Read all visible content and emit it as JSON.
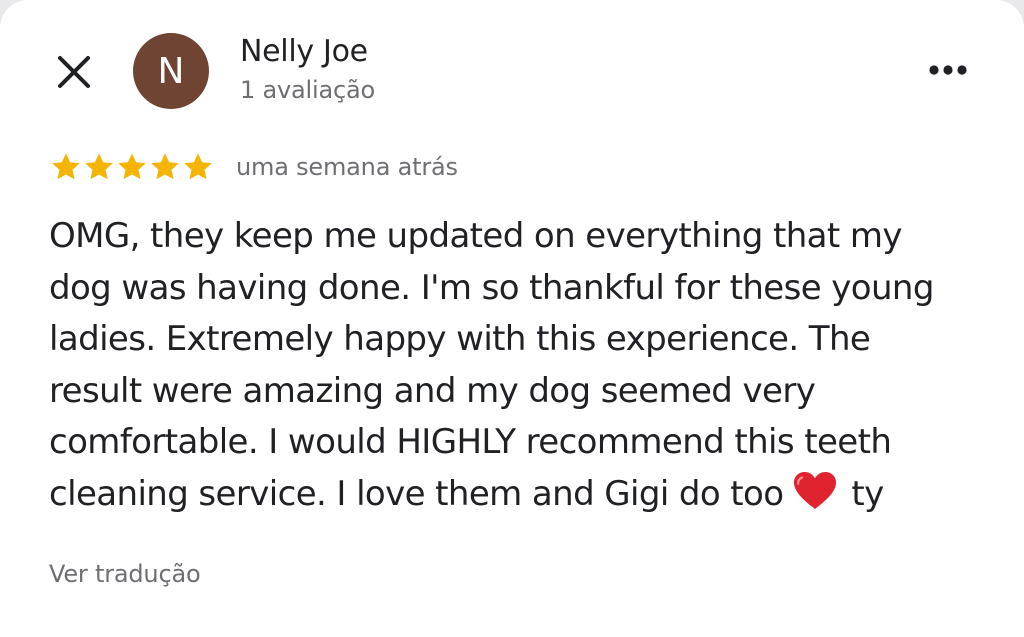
{
  "reviewer": {
    "avatar_initial": "N",
    "avatar_color": "#6f4433",
    "name": "Nelly Joe",
    "review_count": "1 avaliação"
  },
  "review": {
    "rating": 5,
    "max_rating": 5,
    "star_color": "#f4b400",
    "time_ago": "uma semana atrás",
    "text_main": "OMG, they keep me updated on everything that my\ndog was having done. I'm so thankful for these young\nladies. Extremely happy with this experience. The\nresult were amazing and my dog seemed very\ncomfortable. I would HIGHLY recommend this teeth\ncleaning service. I love them and Gigi do too",
    "text_emoji": "heart-icon",
    "text_tail": "ty"
  },
  "actions": {
    "close_icon": "close-icon",
    "more_icon": "more-horizontal-icon",
    "translate_label": "Ver tradução"
  }
}
